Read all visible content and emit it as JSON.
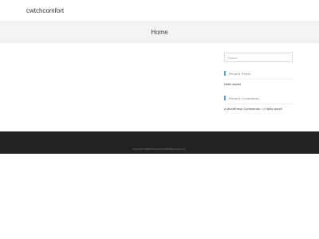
{
  "header": {
    "site_title": "cwtchcomfort"
  },
  "banner": {
    "page_title": "Home"
  },
  "sidebar": {
    "search": {
      "placeholder": "Search"
    },
    "recent_posts": {
      "heading": "Recent Posts",
      "items": [
        {
          "label": "Hello world!"
        }
      ]
    },
    "recent_comments": {
      "heading": "Recent Comments",
      "items": [
        {
          "author": "A WordPress Commenter",
          "on": "on",
          "post": "Hello world!"
        }
      ]
    }
  },
  "footer": {
    "copyright": "Copyright ©2023 Powered by WordPress.com Inc."
  },
  "colors": {
    "accent": "#58a6d6",
    "footer_bg": "#222222",
    "banner_bg": "#f4f4f4"
  }
}
